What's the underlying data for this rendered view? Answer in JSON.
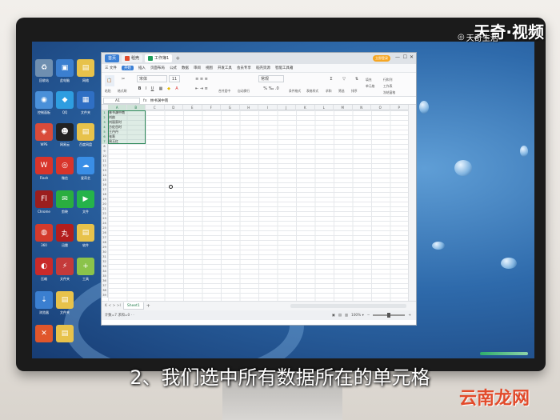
{
  "wps": {
    "tabs": [
      {
        "label": "首页",
        "icon": "home-icon"
      },
      {
        "label": "稻壳",
        "icon": "docer-icon"
      },
      {
        "label": "工作簿1",
        "icon": "spreadsheet-icon"
      }
    ],
    "new_tab": "+",
    "login_badge": "立即登录",
    "window_controls": [
      "—",
      "☐",
      "✕"
    ],
    "menus": [
      "三 文件",
      "开始",
      "插入",
      "页面布局",
      "公式",
      "数据",
      "审阅",
      "视图",
      "开发工具",
      "会员专享",
      "稻壳资源",
      "智能工具箱"
    ],
    "ribbon": {
      "paste": "粘贴",
      "format_painter": "格式刷",
      "font": "宋体",
      "font_size": "11",
      "merge": "合并居中",
      "wrap": "自动换行",
      "number_format": "常规",
      "conditional": "条件格式",
      "table_style": "表格样式",
      "sum": "求和",
      "filter": "筛选",
      "sort": "排序",
      "fill": "填充",
      "cells": "单元格",
      "rowcol": "行和列",
      "worksheet": "工作表",
      "freeze": "冻结窗格"
    },
    "formula_bar": {
      "name_box": "A1",
      "fx": "fx",
      "value": "林书渊中南"
    },
    "columns": [
      "A",
      "B",
      "C",
      "D",
      "E",
      "F",
      "G",
      "H",
      "I",
      "J",
      "K",
      "L",
      "M",
      "N",
      "O",
      "P",
      "Q"
    ],
    "rows": [
      "1",
      "2",
      "3",
      "4",
      "5",
      "6",
      "7",
      "8",
      "9",
      "10",
      "11",
      "12",
      "13",
      "14",
      "15",
      "16",
      "17",
      "18",
      "19",
      "20",
      "21",
      "22",
      "23",
      "24",
      "25",
      "26",
      "27",
      "28",
      "29",
      "30",
      "31",
      "32",
      "33",
      "34",
      "35",
      "36",
      "37",
      "38",
      "39"
    ],
    "cells": [
      "林书渊中南",
      "刘韵",
      "刘丽家时",
      "方佐岳时",
      "王丹丹",
      "张莉",
      "周玉红"
    ],
    "sheet_nav": "K  <  >  >I",
    "sheet_tab": "Sheet1",
    "sheet_add": "+",
    "status_left": "计数=7  求和=0  ·  ·",
    "zoom": "100% ▾"
  },
  "desktop_icons": [
    "回收站",
    "此电脑",
    "网络",
    "控制面板",
    "QQ",
    "文件夹",
    "WPS",
    "网易云",
    "百度网盘",
    "Flash",
    "微信",
    "爱奇艺",
    "Chrome",
    "剪映",
    "文件",
    "360",
    "迅雷",
    "软件",
    "压缩",
    "文件夹",
    "工具",
    "浏览器",
    "文件夹"
  ],
  "watermark": {
    "brand": "天奇·视频",
    "sub": "天奇生活"
  },
  "subtitle": "2、我们选中所有数据所在的单元格",
  "logo": "云南龙网",
  "colors": {
    "accent": "#3a7fd5",
    "selection": "#2f8a5b",
    "logo": "#e24b2b"
  }
}
